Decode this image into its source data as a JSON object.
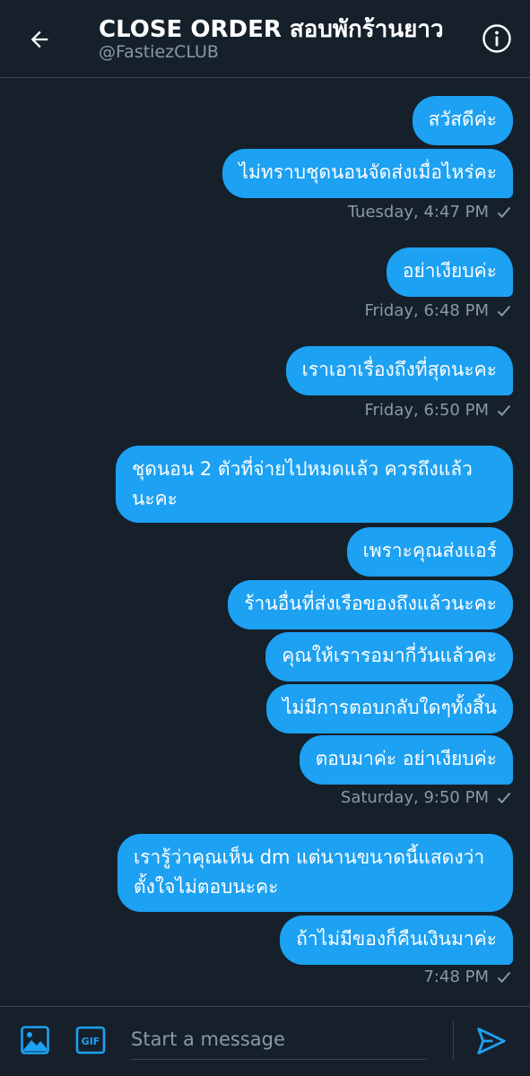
{
  "header": {
    "title": "CLOSE ORDER สอบพักร้านยาว",
    "handle": "@FastiezCLUB"
  },
  "messages": [
    {
      "text": "สวัสดีค่ะ"
    },
    {
      "text": "ไม่ทราบชุดนอนจัดส่งเมื่อไหร่คะ"
    },
    {
      "text": "อย่าเงียบค่ะ"
    },
    {
      "text": "เราเอาเรื่องถึงที่สุดนะคะ"
    },
    {
      "text": "ชุดนอน 2 ตัวที่จ่ายไปหมดแล้ว ควรถึงแล้ว นะคะ"
    },
    {
      "text": "เพราะคุณส่งแอร์"
    },
    {
      "text": "ร้านอื่นที่ส่งเรือของถึงแล้วนะคะ"
    },
    {
      "text": "คุณให้เรารอมากี่วันแล้วคะ"
    },
    {
      "text": "ไม่มีการตอบกลับใดๆทั้งสิ้น"
    },
    {
      "text": "ตอบมาค่ะ อย่าเงียบค่ะ"
    },
    {
      "text": "เรารู้ว่าคุณเห็น dm แต่นานขนาดนี้แสดงว่า ตั้งใจไม่ตอบนะคะ"
    },
    {
      "text": "ถ้าไม่มีของก็คืนเงินมาค่ะ"
    }
  ],
  "timestamps": [
    {
      "text": "Tuesday, 4:47 PM"
    },
    {
      "text": "Friday, 6:48 PM"
    },
    {
      "text": "Friday, 6:50 PM"
    },
    {
      "text": "Saturday, 9:50 PM"
    },
    {
      "text": "7:48 PM"
    }
  ],
  "composer": {
    "placeholder": "Start a message"
  },
  "icons": {
    "back": "arrow-left-icon",
    "info": "info-icon",
    "media": "image-icon",
    "gif": "gif-icon",
    "send": "send-icon",
    "check": "check-icon"
  },
  "colors": {
    "background": "#15202b",
    "bubble": "#1da1f2",
    "muted": "#8899a6",
    "divider": "#38444d"
  }
}
